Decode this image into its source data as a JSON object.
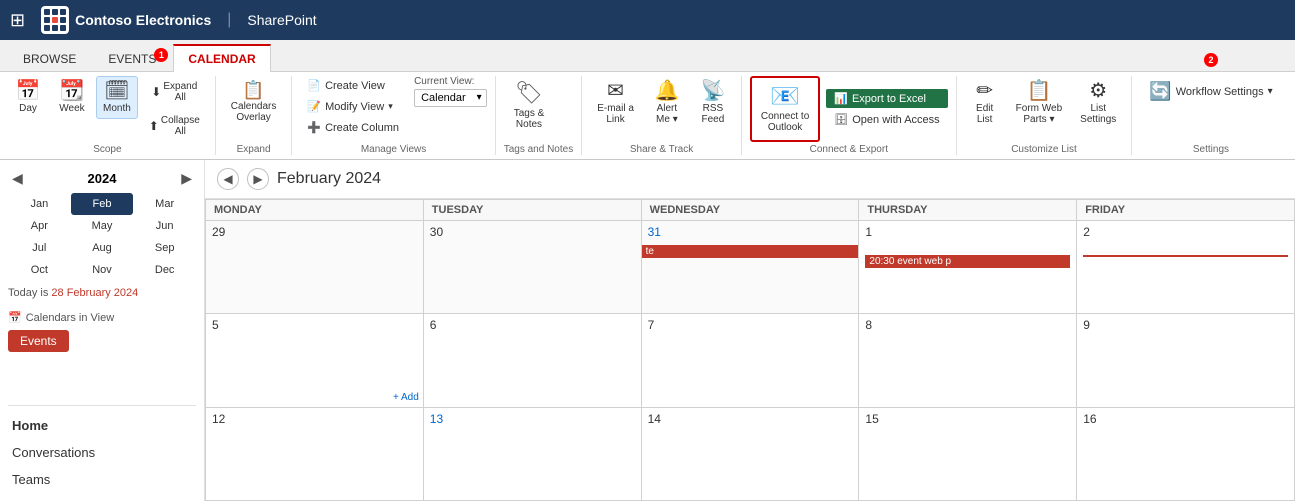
{
  "topbar": {
    "grid_icon": "⊞",
    "company": "Contoso Electronics",
    "separator": "|",
    "app": "SharePoint"
  },
  "ribbon": {
    "tabs": [
      {
        "id": "browse",
        "label": "BROWSE",
        "active": false
      },
      {
        "id": "events",
        "label": "EVENTS",
        "active": false,
        "badge": "1"
      },
      {
        "id": "calendar",
        "label": "CALENDAR",
        "active": true
      }
    ],
    "groups": {
      "scope": {
        "label": "Scope",
        "items": [
          {
            "id": "day",
            "label": "Day",
            "icon": "📅"
          },
          {
            "id": "week",
            "label": "Week",
            "icon": "📆"
          },
          {
            "id": "month",
            "label": "Month",
            "icon": "🗓",
            "active": true
          },
          {
            "id": "expand-all",
            "label": "Expand All",
            "icon": "⬇"
          },
          {
            "id": "collapse-all",
            "label": "Collapse All",
            "icon": "⬆"
          }
        ]
      },
      "expand": {
        "label": "Expand",
        "calendars_overlay_label": "Calendars Overlay"
      },
      "manage_views": {
        "label": "Manage Views",
        "create_view": "Create View",
        "modify_view": "Modify View",
        "create_column": "Create Column",
        "current_view_label": "Current View:",
        "current_view_value": "Calendar"
      },
      "tags_and_notes": {
        "label": "Tags and Notes",
        "icon": "🏷",
        "button": "Tags & Notes"
      },
      "share_track": {
        "label": "Share & Track",
        "email": "E-mail a Link",
        "alert": "Alert Me",
        "rss": "RSS Feed"
      },
      "connect_export": {
        "label": "Connect & Export",
        "connect_outlook": "Connect to Outlook",
        "export_excel": "Export to Excel",
        "open_access": "Open with Access",
        "highlighted": true
      },
      "customize_list": {
        "label": "Customize List",
        "edit_list": "Edit List",
        "form_web_parts": "Form Web Parts",
        "list_settings": "List Settings"
      },
      "settings": {
        "label": "Settings",
        "workflow": "Workflow Settings",
        "badge": "2"
      }
    }
  },
  "mini_calendar": {
    "year": "2024",
    "months": [
      [
        "Jan",
        "Feb",
        "Mar"
      ],
      [
        "Apr",
        "May",
        "Jun"
      ],
      [
        "Jul",
        "Aug",
        "Sep"
      ],
      [
        "Oct",
        "Nov",
        "Dec"
      ]
    ],
    "selected_month": "Feb",
    "today": "28 February 2024",
    "today_label": "Today is"
  },
  "calendars_in_view": {
    "title": "Calendars in View",
    "events_button": "Events"
  },
  "sidebar_nav": [
    {
      "id": "home",
      "label": "Home",
      "active": true
    },
    {
      "id": "conversations",
      "label": "Conversations",
      "active": false
    },
    {
      "id": "teams",
      "label": "Teams",
      "active": false
    }
  ],
  "calendar": {
    "title": "February 2024",
    "day_headers": [
      "MONDAY",
      "TUESDAY",
      "WEDNESDAY",
      "THURSDAY",
      "FRIDAY"
    ],
    "weeks": [
      {
        "days": [
          {
            "date": "29",
            "prev_month": true,
            "link": false
          },
          {
            "date": "30",
            "prev_month": true,
            "link": false
          },
          {
            "date": "31",
            "prev_month": true,
            "link": true,
            "event_span": true,
            "event_span_text": "te"
          },
          {
            "date": "1",
            "link": false,
            "event_20": "20:30 event web p"
          },
          {
            "date": "2",
            "link": false,
            "event_20_cont": true
          }
        ]
      },
      {
        "days": [
          {
            "date": "5",
            "link": false,
            "add": true
          },
          {
            "date": "6",
            "link": false
          },
          {
            "date": "7",
            "link": false
          },
          {
            "date": "8",
            "link": false
          },
          {
            "date": "9",
            "link": false
          }
        ]
      },
      {
        "days": [
          {
            "date": "12",
            "link": false
          },
          {
            "date": "13",
            "link": true
          },
          {
            "date": "14",
            "link": false
          },
          {
            "date": "15",
            "link": false
          },
          {
            "date": "16",
            "link": false
          }
        ]
      }
    ]
  }
}
